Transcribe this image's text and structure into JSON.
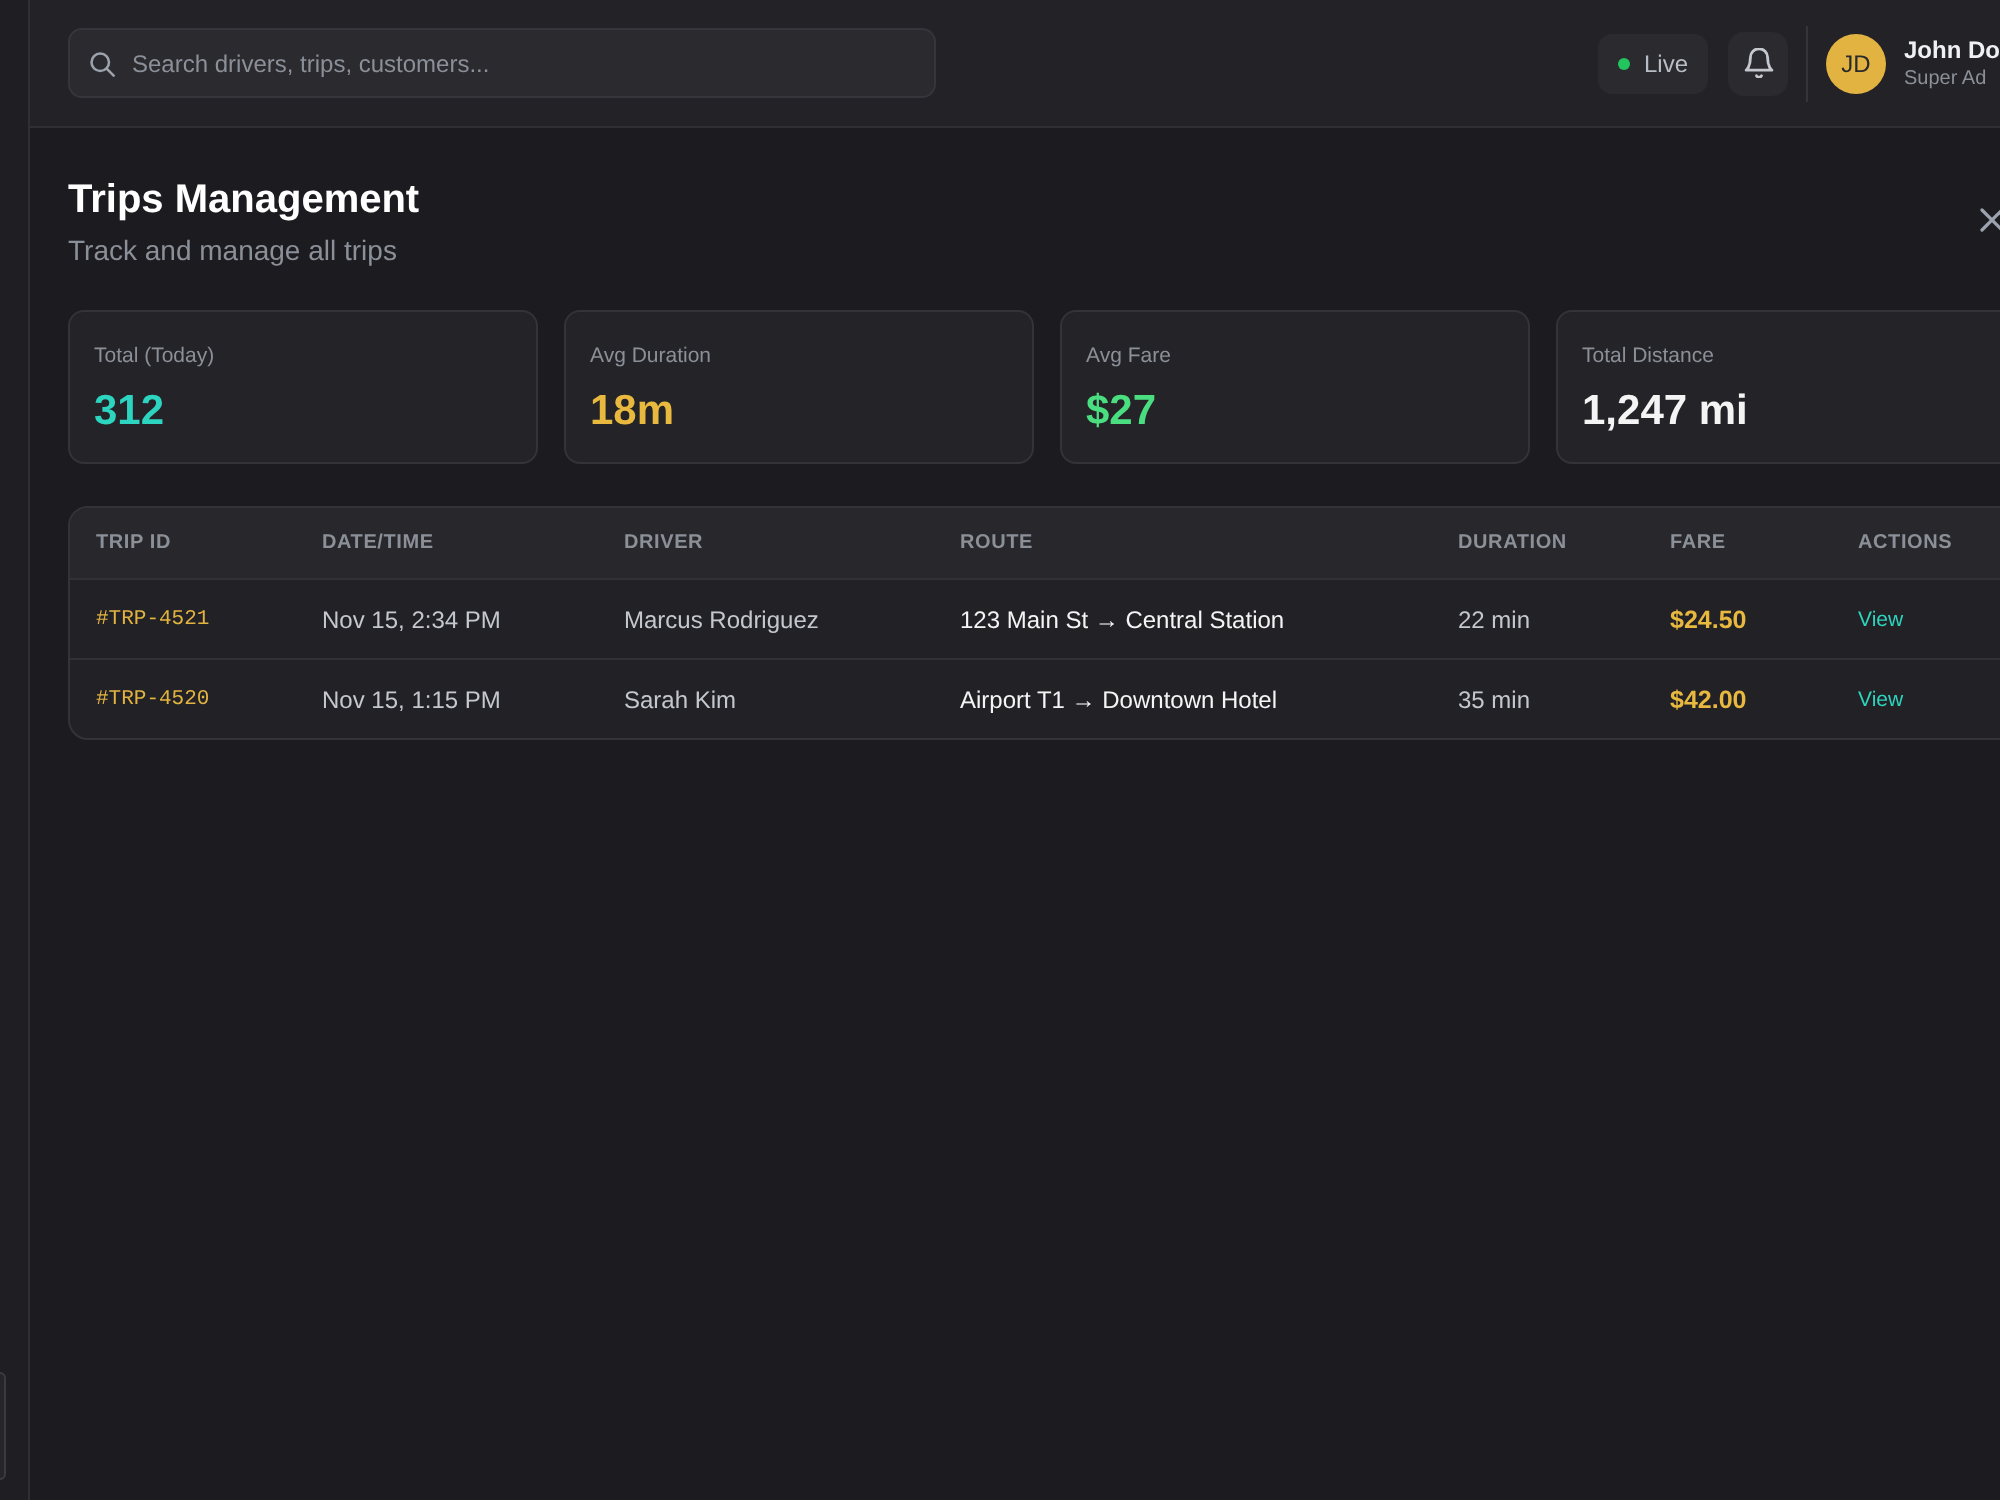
{
  "search": {
    "placeholder": "Search drivers, trips, customers..."
  },
  "status": {
    "label": "Live"
  },
  "user": {
    "initials": "JD",
    "name": "John Do",
    "role": "Super Ad"
  },
  "page": {
    "title": "Trips Management",
    "subtitle": "Track and manage all trips"
  },
  "stats": [
    {
      "label": "Total (Today)",
      "value": "312",
      "color": "#2dd4bf"
    },
    {
      "label": "Avg Duration",
      "value": "18m",
      "color": "#e8b93e"
    },
    {
      "label": "Avg Fare",
      "value": "$27",
      "color": "#4ade80"
    },
    {
      "label": "Total Distance",
      "value": "1,247 mi",
      "color": "#f4f4f5"
    }
  ],
  "table": {
    "columns": [
      "TRIP ID",
      "DATE/TIME",
      "DRIVER",
      "ROUTE",
      "DURATION",
      "FARE",
      "ACTIONS"
    ],
    "rows": [
      {
        "trip_id": "#TRP-4521",
        "date_time": "Nov 15, 2:34 PM",
        "driver": "Marcus Rodriguez",
        "route": "123 Main St → Central Station",
        "duration": "22 min",
        "fare": "$24.50",
        "action": "View"
      },
      {
        "trip_id": "#TRP-4520",
        "date_time": "Nov 15, 1:15 PM",
        "driver": "Sarah Kim",
        "route": "Airport T1 → Downtown Hotel",
        "duration": "35 min",
        "fare": "$42.00",
        "action": "View"
      }
    ]
  }
}
